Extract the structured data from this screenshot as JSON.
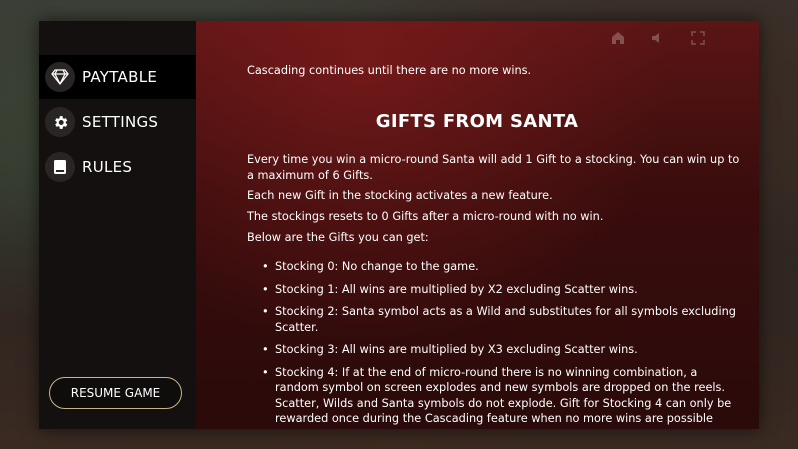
{
  "sidebar": {
    "items": [
      {
        "label": "PAYTABLE",
        "icon": "diamond-icon"
      },
      {
        "label": "SETTINGS",
        "icon": "gear-icon"
      },
      {
        "label": "RULES",
        "icon": "book-icon"
      }
    ],
    "active_index": 0,
    "resume_label": "RESUME GAME"
  },
  "content": {
    "intro": "Cascading continues until there are no more wins.",
    "section_title": "GIFTS FROM SANTA",
    "paragraphs": [
      "Every time you win a micro-round Santa will add 1 Gift to a stocking. You can win up to a maximum of 6 Gifts.",
      "Each new Gift in the stocking activates a new feature.",
      "The stockings resets to 0 Gifts after a micro-round with no win.",
      "Below are the Gifts you can get:"
    ],
    "gifts": [
      "Stocking 0: No change to the game.",
      "Stocking 1: All wins are multiplied by X2 excluding Scatter wins.",
      "Stocking 2: Santa symbol acts as a Wild and substitutes for all symbols excluding Scatter.",
      "Stocking 3: All wins are multiplied by X3 excluding Scatter wins.",
      "Stocking 4: If at the end of micro-round there is no winning combination, a random symbol on screen explodes and new symbols are dropped on the reels. Scatter, Wilds and Santa symbols do not explode. Gift for Stocking 4 can only be rewarded once during the Cascading feature when no more wins are possible giving another chance for a potential win."
    ]
  },
  "scroll": {
    "position_fraction": 0.1
  },
  "colors": {
    "accent": "#d9b36a",
    "panel_red": "#5b1515",
    "sidebar": "#141010"
  },
  "close_icon": "close-icon"
}
